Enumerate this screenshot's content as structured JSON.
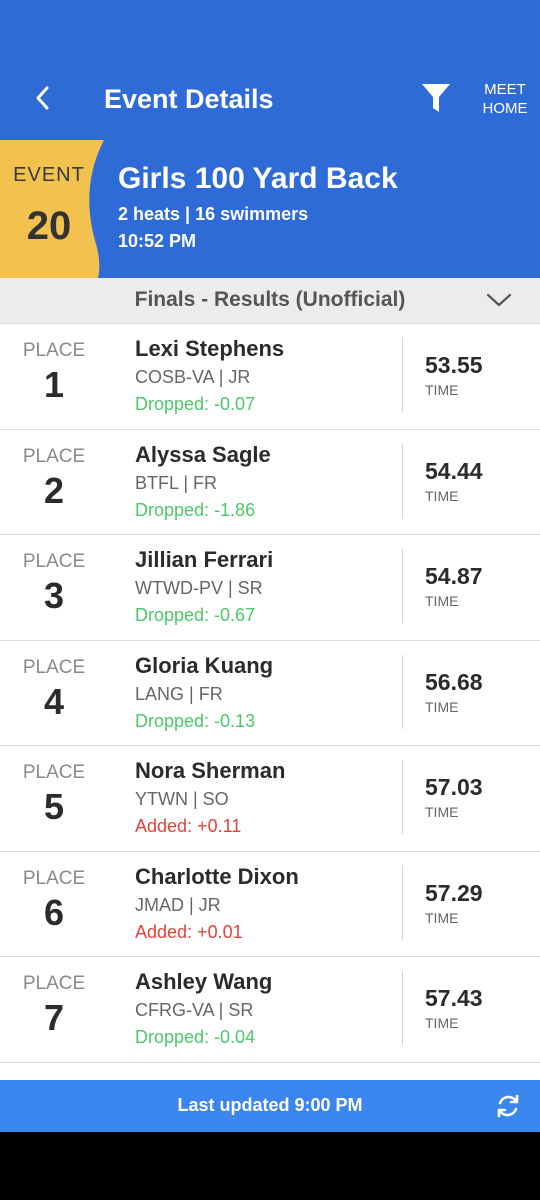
{
  "app_bar": {
    "title": "Event Details",
    "meet_home_line1": "MEET",
    "meet_home_line2": "HOME",
    "icons": [
      "back-chevron-icon",
      "filter-icon"
    ],
    "background": "#2f6bd6"
  },
  "event": {
    "label": "EVENT",
    "number": "20",
    "title": "Girls 100 Yard Back",
    "meta": "2 heats | 16 swimmers",
    "time": "10:52 PM",
    "badge_color": "#f2c14e"
  },
  "section": {
    "title": "Finals - Results (Unofficial)",
    "icon": "chevron-down-icon"
  },
  "results": [
    {
      "place_label": "PLACE",
      "place": "1",
      "name": "Lexi Stephens",
      "team": "COSB-VA | JR",
      "diff": "Dropped: -0.07",
      "diff_type": "dropped",
      "time": "53.55",
      "time_label": "TIME"
    },
    {
      "place_label": "PLACE",
      "place": "2",
      "name": "Alyssa Sagle",
      "team": "BTFL | FR",
      "diff": "Dropped: -1.86",
      "diff_type": "dropped",
      "time": "54.44",
      "time_label": "TIME"
    },
    {
      "place_label": "PLACE",
      "place": "3",
      "name": "Jillian Ferrari",
      "team": "WTWD-PV | SR",
      "diff": "Dropped: -0.67",
      "diff_type": "dropped",
      "time": "54.87",
      "time_label": "TIME"
    },
    {
      "place_label": "PLACE",
      "place": "4",
      "name": "Gloria Kuang",
      "team": "LANG | FR",
      "diff": "Dropped: -0.13",
      "diff_type": "dropped",
      "time": "56.68",
      "time_label": "TIME"
    },
    {
      "place_label": "PLACE",
      "place": "5",
      "name": "Nora Sherman",
      "team": "YTWN | SO",
      "diff": "Added: +0.11",
      "diff_type": "added",
      "time": "57.03",
      "time_label": "TIME"
    },
    {
      "place_label": "PLACE",
      "place": "6",
      "name": "Charlotte Dixon",
      "team": "JMAD | JR",
      "diff": "Added: +0.01",
      "diff_type": "added",
      "time": "57.29",
      "time_label": "TIME"
    },
    {
      "place_label": "PLACE",
      "place": "7",
      "name": "Ashley Wang",
      "team": "CFRG-VA | SR",
      "diff": "Dropped: -0.04",
      "diff_type": "dropped",
      "time": "57.43",
      "time_label": "TIME"
    }
  ],
  "status": {
    "updated": "Last updated 9:00 PM",
    "icon": "refresh-icon",
    "background": "#3b86ee"
  },
  "colors": {
    "dropped": "#4cc86a",
    "added": "#e5403a"
  }
}
